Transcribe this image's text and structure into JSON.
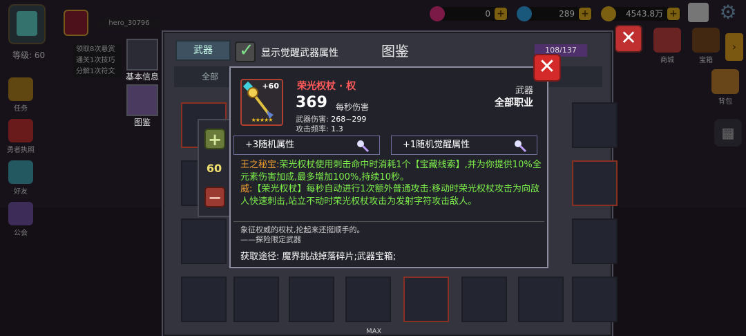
{
  "hud": {
    "level": "等级: 60",
    "player_name": "hero_30796",
    "quests": [
      "领取8次悬赏",
      "通关1次技巧",
      "分解1次符文"
    ],
    "resources": [
      {
        "name": "gem",
        "value": "0",
        "color": "#e03080"
      },
      {
        "name": "diamond",
        "value": "289",
        "color": "#30a0e0"
      },
      {
        "name": "gold",
        "value": "4543.8万",
        "color": "#e0b020"
      }
    ],
    "left_nav": [
      {
        "label": "任务",
        "color": "#b08020"
      },
      {
        "label": "勇者执照",
        "color": "#c03030"
      },
      {
        "label": "好友",
        "color": "#40a0b0"
      },
      {
        "label": "公会",
        "color": "#7050a0"
      }
    ],
    "right_nav": [
      {
        "label": "商城"
      },
      {
        "label": "宝箱"
      },
      {
        "label": "背包"
      }
    ],
    "bottom_max": "MAX"
  },
  "codex": {
    "title": "图鉴",
    "tab_weapon": "武器",
    "count": "108/137",
    "close": "✕",
    "side_tabs": [
      "基本信息",
      "图鉴"
    ],
    "filter_all": "全部",
    "awaken_toggle": "显示觉醒武器属性",
    "awaken_checked": true
  },
  "stepper": {
    "value": "60",
    "plus": "+",
    "minus": "−"
  },
  "tooltip": {
    "close": "✕",
    "item": {
      "name": "荣光权杖 · 权",
      "enhance": "+60",
      "stars": "★★★★★",
      "dps_value": "369",
      "dps_label": "每秒伤害",
      "damage_label": "武器伤害:",
      "damage_value": "268~299",
      "rate_label": "攻击频率:",
      "rate_value": "1.3",
      "type": "武器",
      "class": "全部职业",
      "rarity_color": "#b04030"
    },
    "attr_buttons": [
      "+3随机属性",
      "+1随机觉醒属性"
    ],
    "effects": [
      {
        "key": "王之秘宝:",
        "text": "荣光权杖使用刺击命中时消耗1个【宝藏线索】,并为你提供10%全元素伤害加成,最多增加100%,持续10秒。"
      },
      {
        "key": "威:",
        "text": "【荣光权杖】每秒自动进行1次额外普通攻击:移动时荣光权杖攻击为向敌人快速刺击,站立不动时荣光权杖攻击为发射字符攻击敌人。"
      }
    ],
    "flavor": [
      "象征权威的权杖,抡起来还挺顺手的。",
      "——探险限定武器"
    ],
    "source": "获取途径: 魔界挑战掉落碎片;武器宝箱;"
  }
}
